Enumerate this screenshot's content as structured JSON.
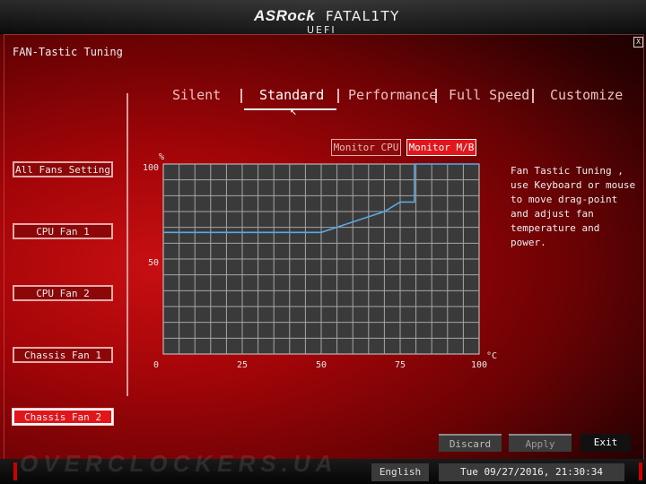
{
  "header": {
    "brand": "ASRock",
    "product": "FATAL1TY",
    "subtitle": "UEFI"
  },
  "page_title": "FAN-Tastic Tuning",
  "close_label": "X",
  "tabs": [
    {
      "label": "Silent",
      "active": false
    },
    {
      "label": "Standard",
      "active": true
    },
    {
      "label": "Performance",
      "active": false
    },
    {
      "label": "Full Speed",
      "active": false
    },
    {
      "label": "Customize",
      "active": false
    }
  ],
  "fans": [
    {
      "label": "All Fans Setting",
      "active": false
    },
    {
      "label": "CPU Fan 1",
      "active": false
    },
    {
      "label": "CPU Fan 2",
      "active": false
    },
    {
      "label": "Chassis Fan 1",
      "active": false
    },
    {
      "label": "Chassis Fan 2",
      "active": true
    }
  ],
  "monitor": {
    "cpu_label": "Monitor CPU",
    "mb_label": "Monitor M/B",
    "selected": "Monitor M/B"
  },
  "chart_data": {
    "type": "line",
    "y_unit": "%",
    "x_unit": "°C",
    "xlim": [
      0,
      100
    ],
    "ylim": [
      0,
      100
    ],
    "x_ticks": [
      "0",
      "25",
      "50",
      "75",
      "100"
    ],
    "y_ticks": [
      "100",
      "50"
    ],
    "grid": true,
    "series": [
      {
        "x": [
          0,
          50,
          70,
          75,
          79.5,
          79.5,
          100
        ],
        "y": [
          64,
          64,
          75,
          80,
          80,
          100,
          100
        ]
      }
    ],
    "colors": {
      "line": "#5aa9e6",
      "grid": "#a6a6a6",
      "background": "#3a3a3a"
    }
  },
  "help_text": "Fan Tastic Tuning , use Keyboard or mouse to move drag-point and adjust fan temperature and power.",
  "actions": {
    "discard": "Discard",
    "apply": "Apply",
    "exit": "Exit"
  },
  "status": {
    "language": "English",
    "datetime": "Tue 09/27/2016, 21:30:34"
  },
  "watermark": "OVERCLOCKERS.UA"
}
